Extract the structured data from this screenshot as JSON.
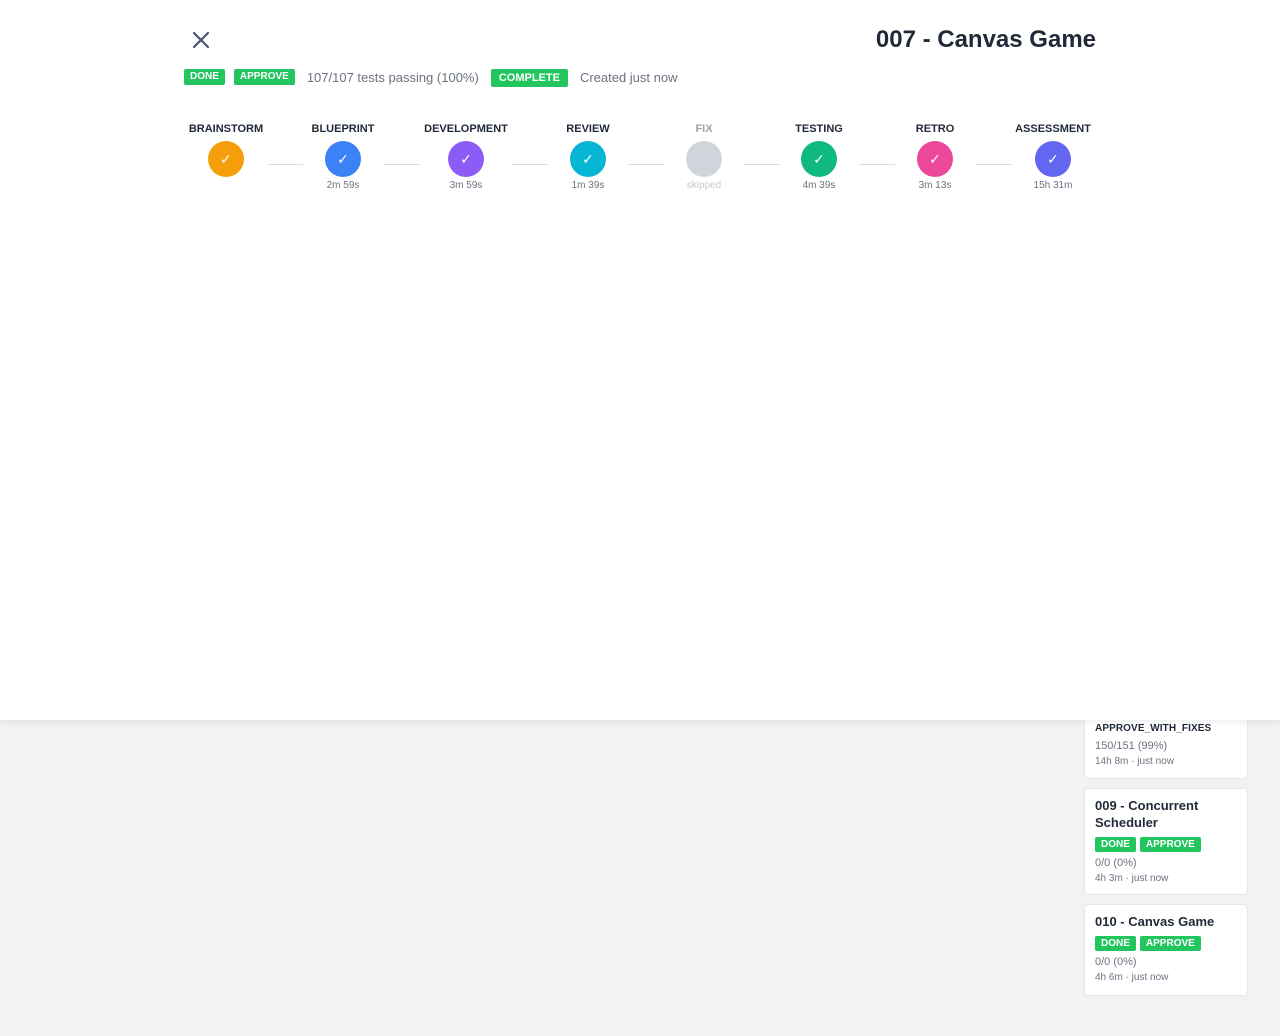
{
  "modal": {
    "title": "007 - Canvas Game",
    "status_badge": "DONE",
    "verdict_badge": "APPROVE",
    "tests_text": "107/107 tests passing (100%)",
    "phase_badge": "COMPLETE",
    "created_text": "Created just now",
    "close_icon": "close-icon",
    "stages": [
      {
        "label": "BRAINSTORM",
        "time": "",
        "color": "#f59e0b",
        "icon": "check-icon",
        "glyph": "✓",
        "state": "done"
      },
      {
        "label": "BLUEPRINT",
        "time": "2m 59s",
        "color": "#3b82f6",
        "icon": "check-icon",
        "glyph": "✓",
        "state": "done"
      },
      {
        "label": "DEVELOPMENT",
        "time": "3m 59s",
        "color": "#8b5cf6",
        "icon": "check-icon",
        "glyph": "✓",
        "state": "done"
      },
      {
        "label": "REVIEW",
        "time": "1m 39s",
        "color": "#06b6d4",
        "icon": "check-icon",
        "glyph": "✓",
        "state": "done"
      },
      {
        "label": "FIX",
        "time": "skipped",
        "color": "#d1d5db",
        "icon": "",
        "glyph": "",
        "state": "skipped"
      },
      {
        "label": "TESTING",
        "time": "4m 39s",
        "color": "#10b981",
        "icon": "check-icon",
        "glyph": "✓",
        "state": "done"
      },
      {
        "label": "RETRO",
        "time": "3m 13s",
        "color": "#ec4899",
        "icon": "check-icon",
        "glyph": "✓",
        "state": "done"
      },
      {
        "label": "ASSESSMENT",
        "time": "15h 31m",
        "color": "#6366f1",
        "icon": "check-icon",
        "glyph": "✓",
        "state": "done"
      }
    ]
  },
  "cards": [
    {
      "title": "",
      "badges": [
        "APPROVE_WITH_FIXES"
      ],
      "tests": "150/151 (99%)",
      "meta": "14h 8m · just now"
    },
    {
      "title": "009 - Concurrent Scheduler",
      "badges": [
        "DONE",
        "APPROVE"
      ],
      "tests": "0/0 (0%)",
      "meta": "4h 3m · just now"
    },
    {
      "title": "010 - Canvas Game",
      "badges": [
        "DONE",
        "APPROVE"
      ],
      "tests": "0/0 (0%)",
      "meta": "4h 6m · just now"
    }
  ],
  "colors": {
    "success": "#22c55e",
    "text": "#1f2937",
    "muted": "#6b7280"
  }
}
